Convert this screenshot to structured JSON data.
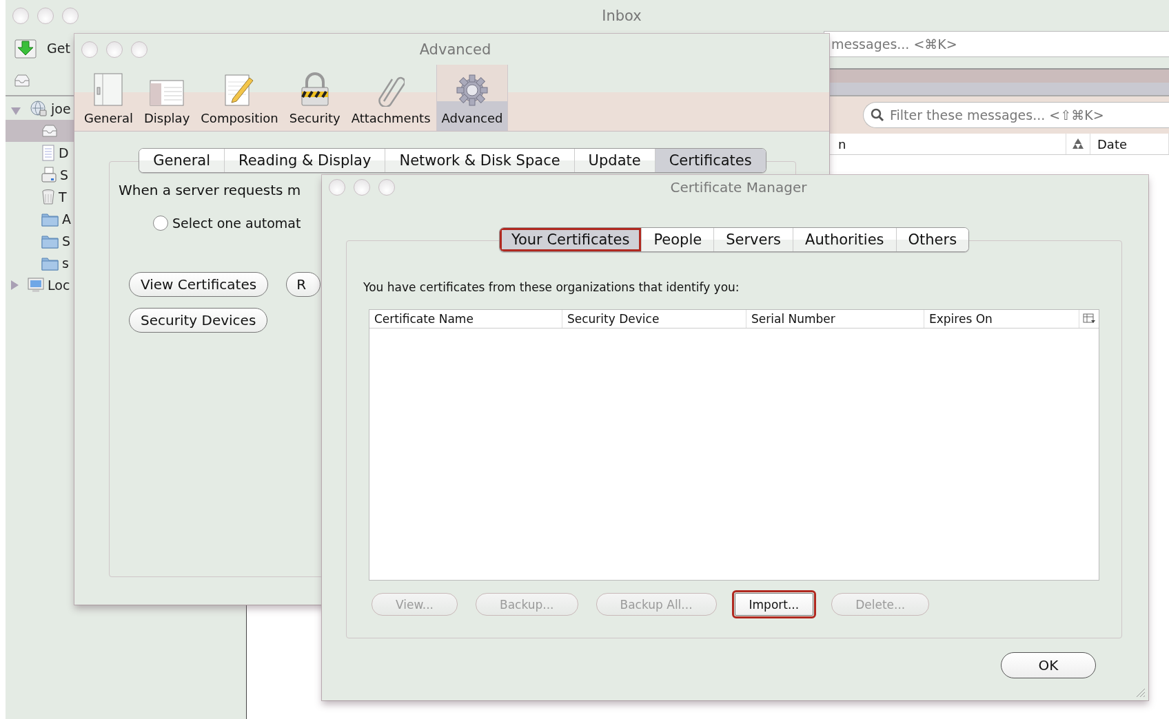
{
  "inbox_window": {
    "title": "Inbox",
    "get_button": "Get",
    "search": {
      "placeholder": "messages... <⌘K>"
    },
    "filter": {
      "placeholder": "Filter these messages... <⇧⌘K>"
    },
    "columns": [
      "n",
      "Date"
    ],
    "folders": [
      {
        "label": "joe",
        "kind": "account",
        "expanded": true,
        "selected": false,
        "children": [
          {
            "kind": "inbox",
            "selected": true
          },
          {
            "label": "D",
            "kind": "drafts",
            "selected": false
          },
          {
            "label": "S",
            "kind": "sent",
            "selected": false
          },
          {
            "label": "T",
            "kind": "trash",
            "selected": false
          },
          {
            "label": "A",
            "kind": "folder",
            "selected": false
          },
          {
            "label": "S",
            "kind": "folder",
            "selected": false
          },
          {
            "label": "s",
            "kind": "folder",
            "selected": false
          }
        ]
      },
      {
        "label": "Loc",
        "kind": "local",
        "expanded": false,
        "selected": false
      }
    ]
  },
  "prefs_window": {
    "title": "Advanced",
    "panes": [
      {
        "label": "General",
        "kind": "general",
        "selected": false
      },
      {
        "label": "Display",
        "kind": "display",
        "selected": false
      },
      {
        "label": "Composition",
        "kind": "composition",
        "selected": false
      },
      {
        "label": "Security",
        "kind": "security",
        "selected": false
      },
      {
        "label": "Attachments",
        "kind": "attachments",
        "selected": false
      },
      {
        "label": "Advanced",
        "kind": "advanced",
        "selected": true
      }
    ],
    "tabs": [
      {
        "label": "General",
        "selected": false
      },
      {
        "label": "Reading & Display",
        "selected": false
      },
      {
        "label": "Network & Disk Space",
        "selected": false
      },
      {
        "label": "Update",
        "selected": false
      },
      {
        "label": "Certificates",
        "selected": true
      }
    ],
    "prompt": "When a server requests m",
    "radio": {
      "label": "Select one automat",
      "selected": false
    },
    "buttons": [
      "View Certificates",
      "R",
      "Security Devices"
    ]
  },
  "certificate_manager": {
    "title": "Certificate Manager",
    "tabs": [
      {
        "label": "Your Certificates",
        "selected": true,
        "highlighted": true
      },
      {
        "label": "People",
        "selected": false,
        "highlighted": false
      },
      {
        "label": "Servers",
        "selected": false,
        "highlighted": false
      },
      {
        "label": "Authorities",
        "selected": false,
        "highlighted": false
      },
      {
        "label": "Others",
        "selected": false,
        "highlighted": false
      }
    ],
    "intro": "You have certificates from these organizations that identify you:",
    "columns": [
      "Certificate Name",
      "Security Device",
      "Serial Number",
      "Expires On"
    ],
    "actions": [
      {
        "label": "View...",
        "disabled": true,
        "highlighted": false
      },
      {
        "label": "Backup...",
        "disabled": true,
        "highlighted": false
      },
      {
        "label": "Backup All...",
        "disabled": true,
        "highlighted": false
      },
      {
        "label": "Import...",
        "disabled": false,
        "highlighted": true
      },
      {
        "label": "Delete...",
        "disabled": true,
        "highlighted": false
      }
    ],
    "ok_button": "OK"
  }
}
